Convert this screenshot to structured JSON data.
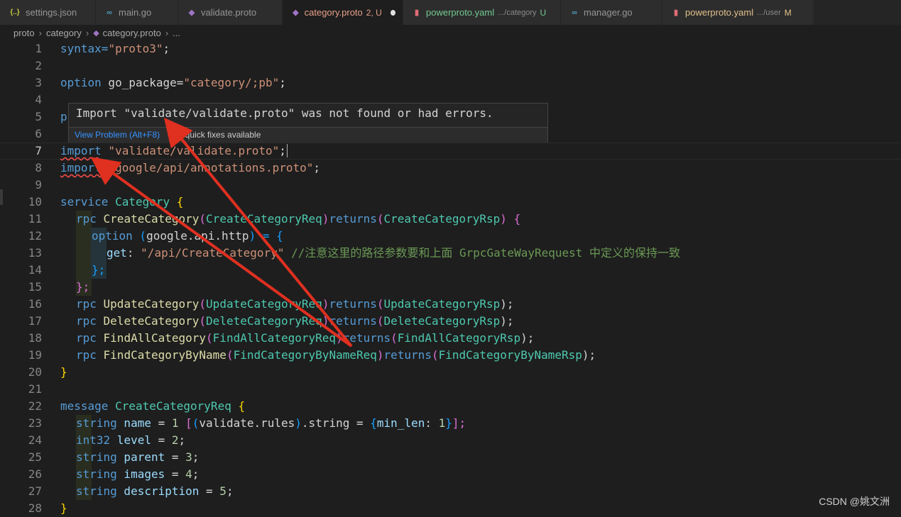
{
  "tabs": [
    {
      "icon": "{..}",
      "label": "settings.json",
      "sub": "",
      "status": ""
    },
    {
      "icon": "∞",
      "label": "main.go",
      "sub": "",
      "status": ""
    },
    {
      "icon": "◆",
      "label": "validate.proto",
      "sub": "",
      "status": ""
    },
    {
      "icon": "◆",
      "label": "category.proto",
      "sub": "",
      "status": "2, U"
    },
    {
      "icon": "▮",
      "label": "powerproto.yaml",
      "sub": ".../category",
      "status": "U"
    },
    {
      "icon": "∞",
      "label": "manager.go",
      "sub": "",
      "status": ""
    },
    {
      "icon": "▮",
      "label": "powerproto.yaml",
      "sub": ".../user",
      "status": "M"
    }
  ],
  "breadcrumb": {
    "part1": "proto",
    "part2": "category",
    "part3": "category.proto",
    "part4": "..."
  },
  "line_numbers": [
    "1",
    "2",
    "3",
    "4",
    "5",
    "6",
    "7",
    "8",
    "9",
    "10",
    "11",
    "12",
    "13",
    "14",
    "15",
    "16",
    "17",
    "18",
    "19",
    "20",
    "21",
    "22",
    "23",
    "24",
    "25",
    "26",
    "27",
    "28"
  ],
  "code": {
    "l1_a": "syntax=",
    "l1_b": "\"proto3\"",
    "l1_c": ";",
    "l3_a": "option",
    "l3_b": " go_package=",
    "l3_c": "\"category/;pb\"",
    "l3_d": ";",
    "l5_a": "p",
    "l7_a": "import",
    "l7_b": " \"validate/validate.proto\"",
    "l7_c": ";",
    "l8_a": "import",
    "l8_b": " \"google/api/annotations.proto\"",
    "l8_c": ";",
    "l10_a": "service",
    "l10_b": " Category ",
    "l10_c": "{",
    "l11_a": "rpc",
    "l11_b": " CreateCategory",
    "l11_c": "(",
    "l11_d": "CreateCategoryReq",
    "l11_e": ")",
    "l11_f": "returns",
    "l11_g": "(",
    "l11_h": "CreateCategoryRsp",
    "l11_i": ")",
    "l11_j": " {",
    "l12_a": "option",
    "l12_b": " (",
    "l12_c": "google.api.http",
    "l12_d": ") = ",
    "l12_e": "{",
    "l13_a": "get",
    "l13_b": ": ",
    "l13_c": "\"/api/CreateCategory\"",
    "l13_d": " //注意这里的路径参数要和上面 GrpcGateWayRequest 中定义的保持一致",
    "l14_a": "};",
    "l15_a": "};",
    "l16_a": "rpc",
    "l16_b": " UpdateCategory",
    "l16_c": "(",
    "l16_d": "UpdateCategoryReq",
    "l16_e": ")",
    "l16_f": "returns",
    "l16_g": "(",
    "l16_h": "UpdateCategoryRsp",
    "l16_i": ");",
    "l17_a": "rpc",
    "l17_b": " DeleteCategory",
    "l17_c": "(",
    "l17_d": "DeleteCategoryReq",
    "l17_e": ")",
    "l17_f": "returns",
    "l17_g": "(",
    "l17_h": "DeleteCategoryRsp",
    "l17_i": ");",
    "l18_a": "rpc",
    "l18_b": " FindAllCategory",
    "l18_c": "(",
    "l18_d": "FindAllCategoryReq",
    "l18_e": ")",
    "l18_f": "returns",
    "l18_g": "(",
    "l18_h": "FindAllCategoryRsp",
    "l18_i": ");",
    "l19_a": "rpc",
    "l19_b": " FindCategoryByName",
    "l19_c": "(",
    "l19_d": "FindCategoryByNameReq",
    "l19_e": ")",
    "l19_f": "returns",
    "l19_g": "(",
    "l19_h": "FindCategoryByNameRsp",
    "l19_i": ");",
    "l20_a": "}",
    "l22_a": "message",
    "l22_b": " CreateCategoryReq ",
    "l22_c": "{",
    "l23_a": "string",
    "l23_b": " name",
    "l23_c": " = ",
    "l23_d": "1",
    "l23_e": " [",
    "l23_f": "(",
    "l23_g": "validate.rules",
    "l23_h": ")",
    "l23_i": ".string = ",
    "l23_j": "{",
    "l23_k": "min_len",
    "l23_l": ": ",
    "l23_m": "1",
    "l23_n": "}",
    "l23_o": "];",
    "l24_a": "int32",
    "l24_b": " level",
    "l24_c": " = ",
    "l24_d": "2",
    "l24_e": ";",
    "l25_a": "string",
    "l25_b": " parent",
    "l25_c": " = ",
    "l25_d": "3",
    "l25_e": ";",
    "l26_a": "string",
    "l26_b": " images",
    "l26_c": " = ",
    "l26_d": "4",
    "l26_e": ";",
    "l27_a": "string",
    "l27_b": " description",
    "l27_c": " = ",
    "l27_d": "5",
    "l27_e": ";",
    "l28_a": "}"
  },
  "hover": {
    "message": "Import \"validate/validate.proto\" was not found or had errors.",
    "view_problem": "View Problem (Alt+F8)",
    "no_fixes": "No quick fixes available"
  },
  "watermark": "CSDN @姚文洲",
  "colors": {
    "error": "#f14c4c",
    "arrow": "#e03020",
    "keyword": "#569cd6",
    "string": "#ce9178",
    "type": "#4ec9b0"
  }
}
